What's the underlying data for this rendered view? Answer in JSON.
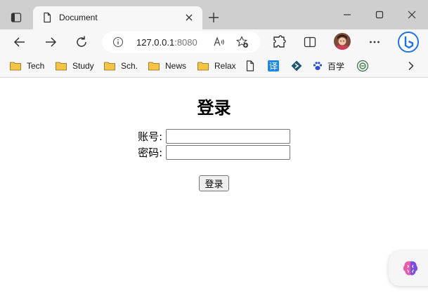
{
  "titlebar": {
    "tab_title": "Document",
    "icons": [
      "tab-actions-icon",
      "document-icon",
      "close-icon",
      "plus-icon",
      "minimize-icon",
      "maximize-icon",
      "close-window-icon"
    ]
  },
  "toolbar": {
    "address_host": "127.0.0.1",
    "address_port": ":8080",
    "icons": [
      "back-arrow-icon",
      "forward-arrow-icon",
      "refresh-icon",
      "info-icon",
      "read-aloud-icon",
      "favorite-star-icon",
      "extensions-icon",
      "split-screen-icon",
      "profile-avatar",
      "more-icon",
      "bing-icon"
    ]
  },
  "bookmarks": {
    "items": [
      {
        "label": "Tech",
        "icon": "folder-icon"
      },
      {
        "label": "Study",
        "icon": "folder-icon"
      },
      {
        "label": "Sch.",
        "icon": "folder-icon"
      },
      {
        "label": "News",
        "icon": "folder-icon"
      },
      {
        "label": "Relax",
        "icon": "folder-icon"
      },
      {
        "label": "",
        "icon": "page-icon"
      },
      {
        "label": "",
        "icon": "translate-icon"
      },
      {
        "label": "",
        "icon": "diamond-icon"
      },
      {
        "label": "百学",
        "icon": "paw-icon"
      },
      {
        "label": "",
        "icon": "circle-logo-icon"
      }
    ],
    "translate_glyph": "译",
    "colors": {
      "folder": "#f5c445",
      "translate": "#1e88e5",
      "diamond": "#1f5577",
      "paw": "#2b4fd6"
    }
  },
  "page": {
    "title": "登录",
    "account_label": "账号:",
    "account_value": "",
    "password_label": "密码:",
    "password_value": "",
    "submit_label": "登录"
  },
  "colors": {
    "accent_bing": "#1a73e8",
    "titlebar": "#cfcfcf",
    "toolbar": "#f7f7f7"
  }
}
